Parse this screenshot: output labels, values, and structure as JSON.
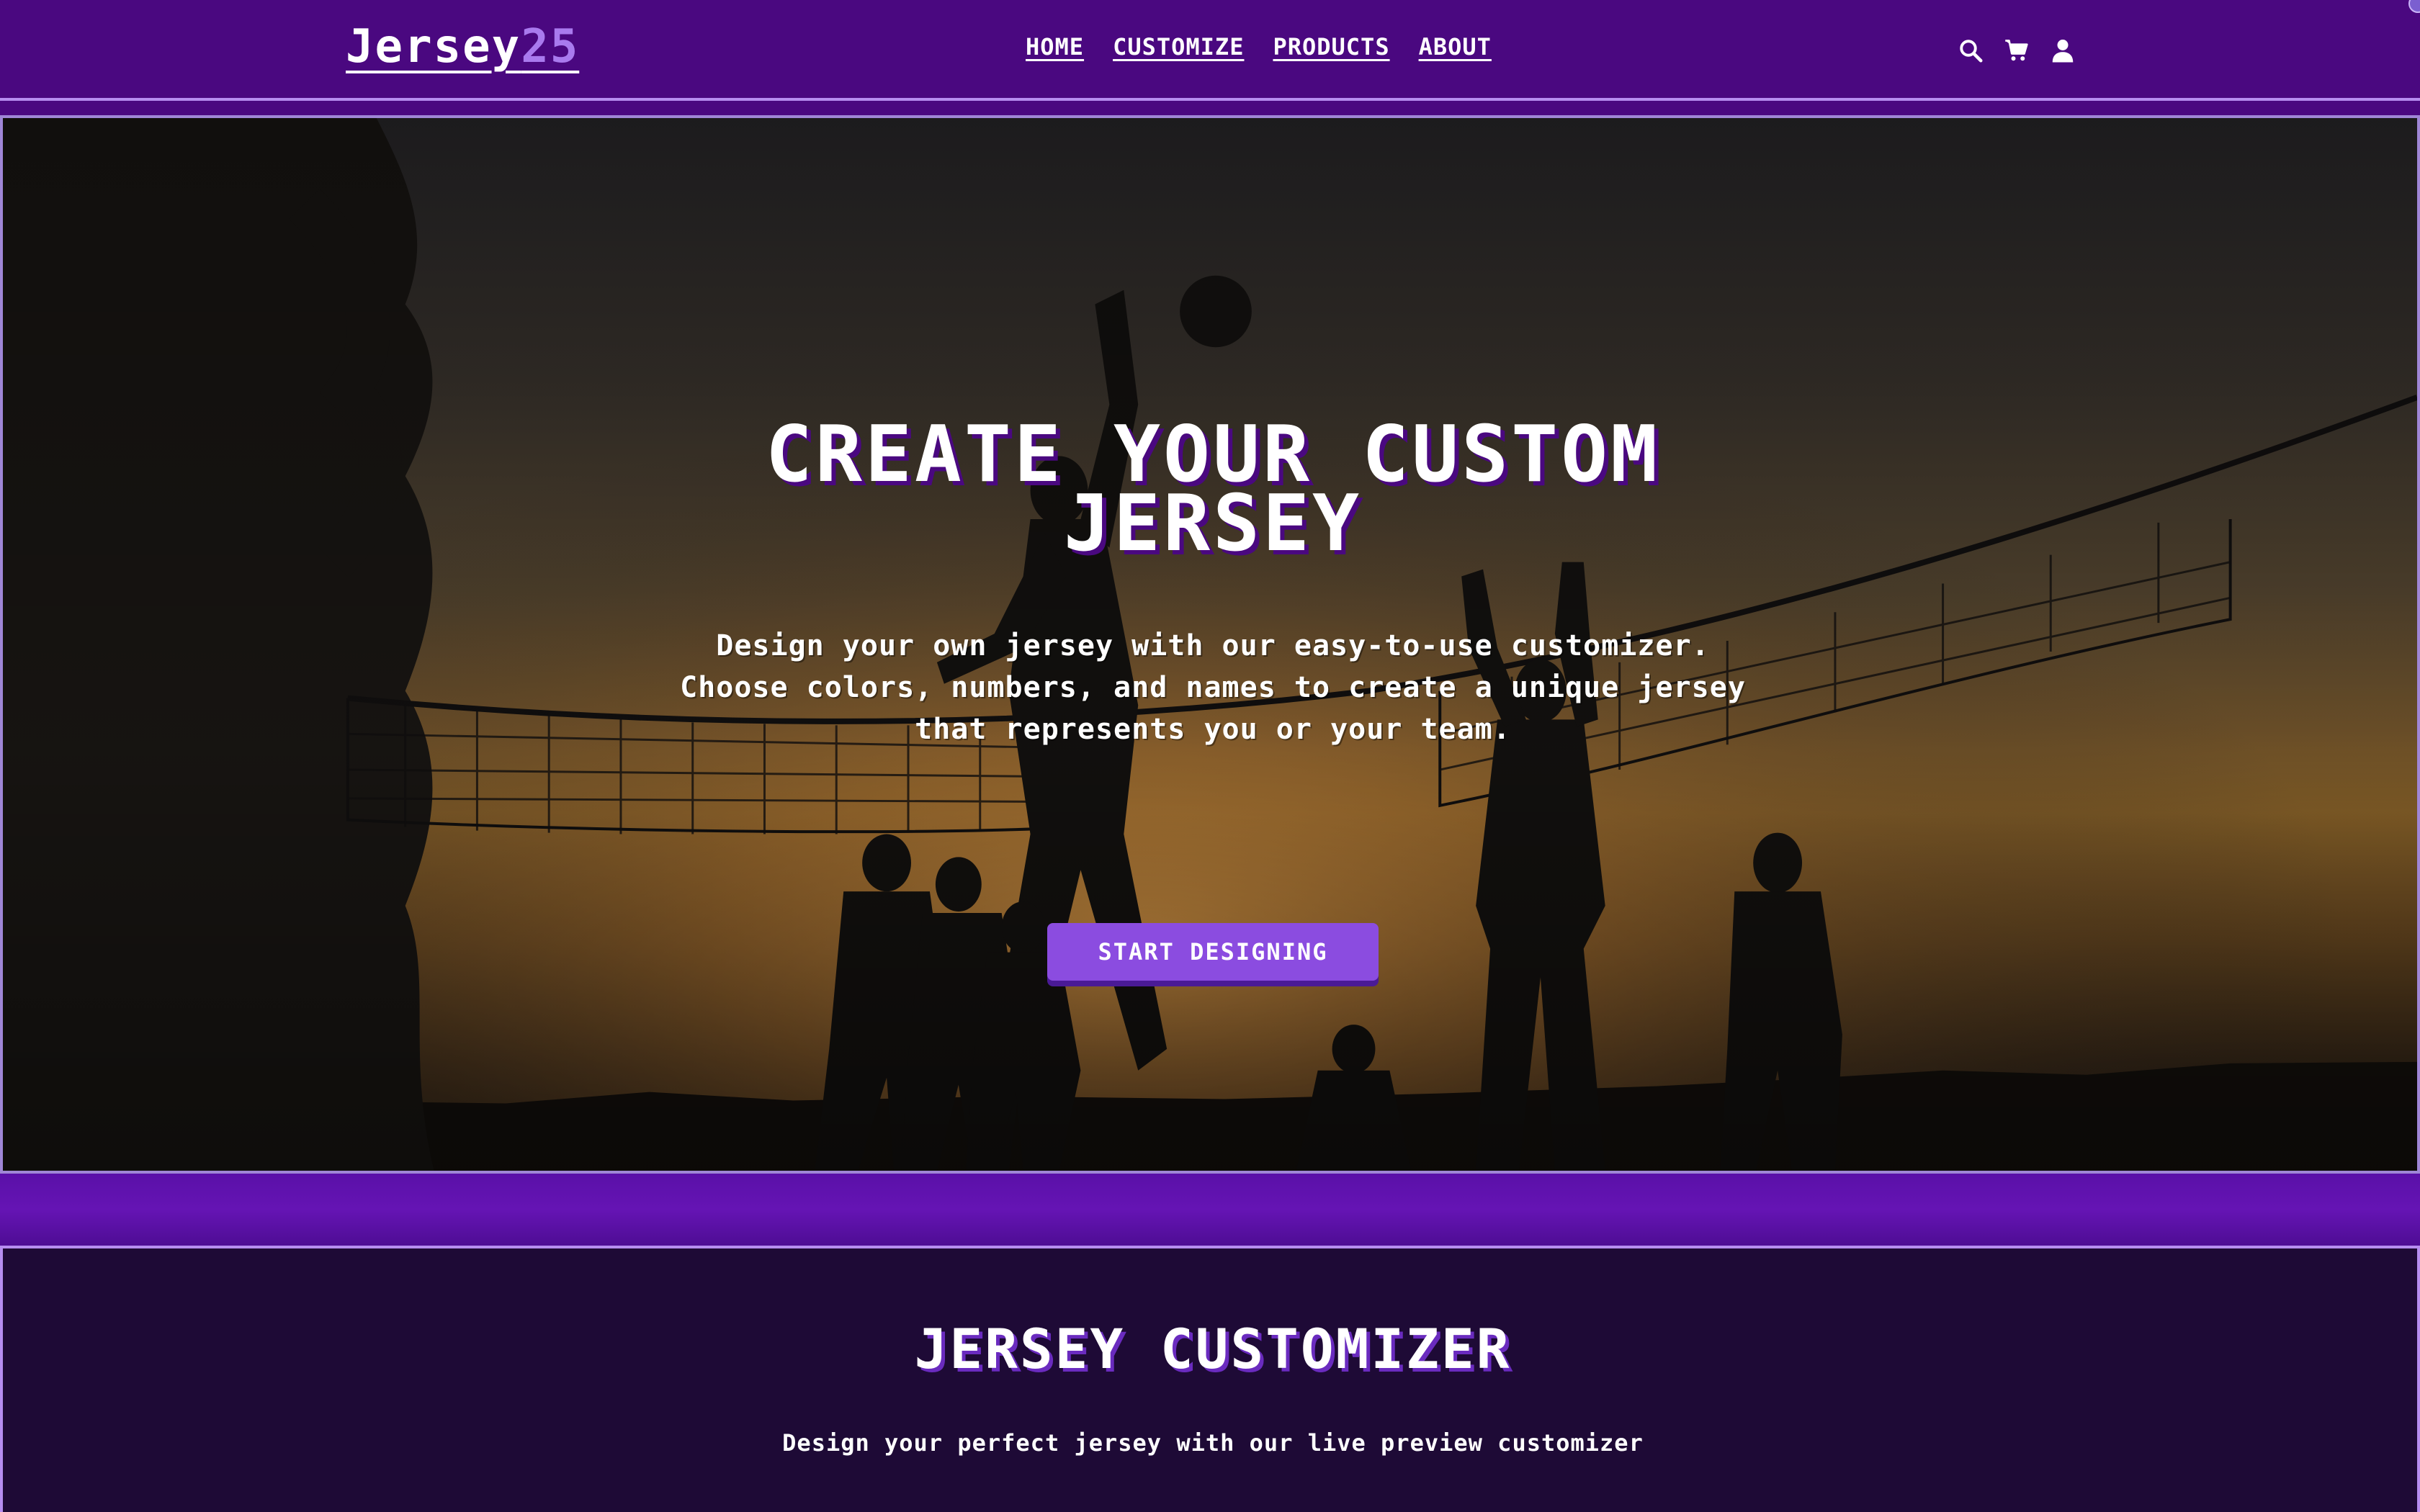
{
  "nav": {
    "logo_main": "Jersey",
    "logo_accent": "25",
    "links": [
      "HOME",
      "CUSTOMIZE",
      "PRODUCTS",
      "ABOUT"
    ],
    "icons": [
      "search-icon",
      "cart-icon",
      "user-icon"
    ]
  },
  "hero": {
    "title": "CREATE YOUR CUSTOM JERSEY",
    "text": "Design your own jersey with our easy-to-use customizer. Choose colors, numbers, and names to create a unique jersey that represents you or your team.",
    "cta_label": "START DESIGNING",
    "image": "volleyball-silhouettes-sunset-photo"
  },
  "customizer": {
    "title": "JERSEY CUSTOMIZER",
    "subtitle": "Design your perfect jersey with our live preview customizer"
  },
  "colors": {
    "nav_bg": "#4a0880",
    "accent": "#a97aee",
    "button": "#8b4ce0",
    "section_bg": "#1e0a36"
  }
}
